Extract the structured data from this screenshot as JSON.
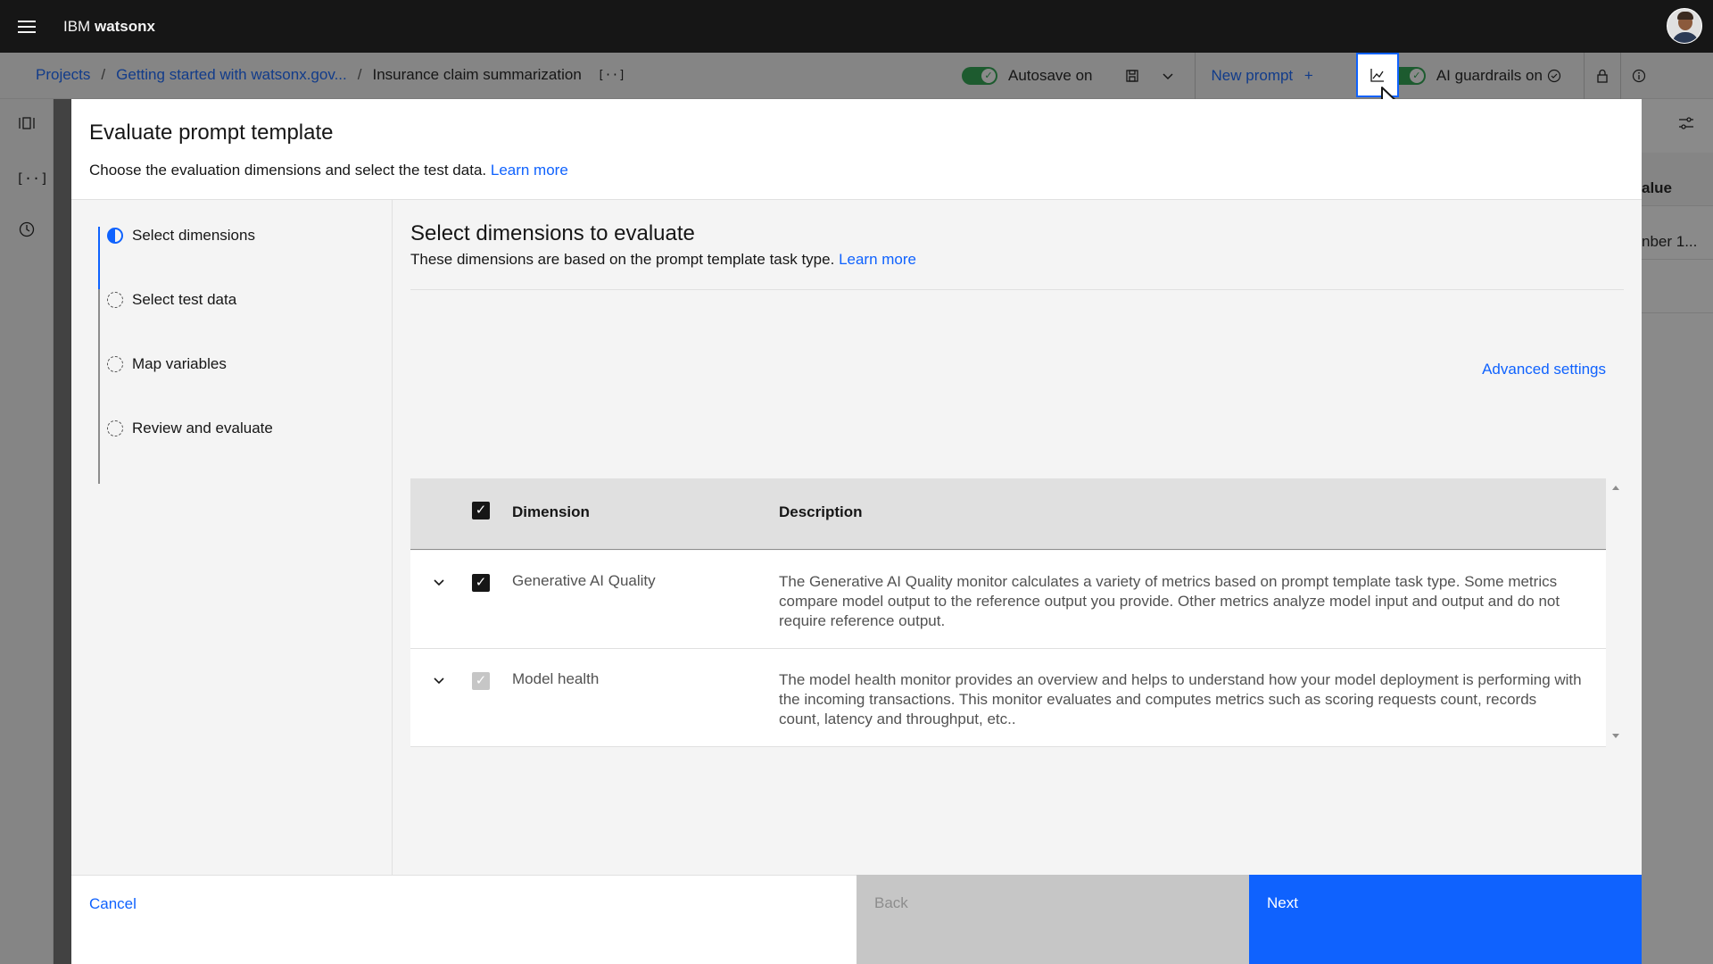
{
  "header": {
    "brand_prefix": "IBM",
    "brand_name": "watsonx"
  },
  "subbar": {
    "crumbs": [
      "Projects",
      "Getting started with watsonx.gov...",
      "Insurance claim summarization"
    ],
    "autosave_label": "Autosave on",
    "new_prompt_label": "New prompt",
    "guardrails_label": "AI guardrails on"
  },
  "background": {
    "table_header_partial": "alue",
    "table_cell_partial": "nber 1..."
  },
  "modal": {
    "title": "Evaluate prompt template",
    "subtitle": "Choose the evaluation dimensions and select the test data.",
    "learn_more": "Learn more",
    "steps": [
      {
        "label": "Select dimensions",
        "state": "current"
      },
      {
        "label": "Select test data",
        "state": "incomplete"
      },
      {
        "label": "Map variables",
        "state": "incomplete"
      },
      {
        "label": "Review and evaluate",
        "state": "incomplete"
      }
    ],
    "content": {
      "title": "Select dimensions to evaluate",
      "subtitle": "These dimensions are based on the prompt template task type.",
      "learn_more": "Learn more",
      "advanced_settings": "Advanced settings",
      "table": {
        "columns": [
          "Dimension",
          "Description"
        ],
        "rows": [
          {
            "name": "Generative AI Quality",
            "checked": true,
            "disabled": false,
            "description": "The Generative AI Quality monitor calculates a variety of metrics based on prompt template task type. Some metrics compare model output to the reference output you provide. Other metrics analyze model input and output and do not require reference output."
          },
          {
            "name": "Model health",
            "checked": true,
            "disabled": true,
            "description": "The model health monitor provides an overview and helps to understand how your model deployment is performing with the incoming transactions. This monitor evaluates and computes metrics such as scoring requests count, records count, latency and throughput, etc.."
          }
        ]
      }
    },
    "footer": {
      "cancel": "Cancel",
      "back": "Back",
      "next": "Next"
    }
  },
  "icons": {
    "check": "✓",
    "chevron_down": "⌄",
    "plus": "+",
    "code": "[··]"
  },
  "colors": {
    "primary": "#0f62fe",
    "toggle_on": "#24a148",
    "header_bg": "#161616"
  }
}
